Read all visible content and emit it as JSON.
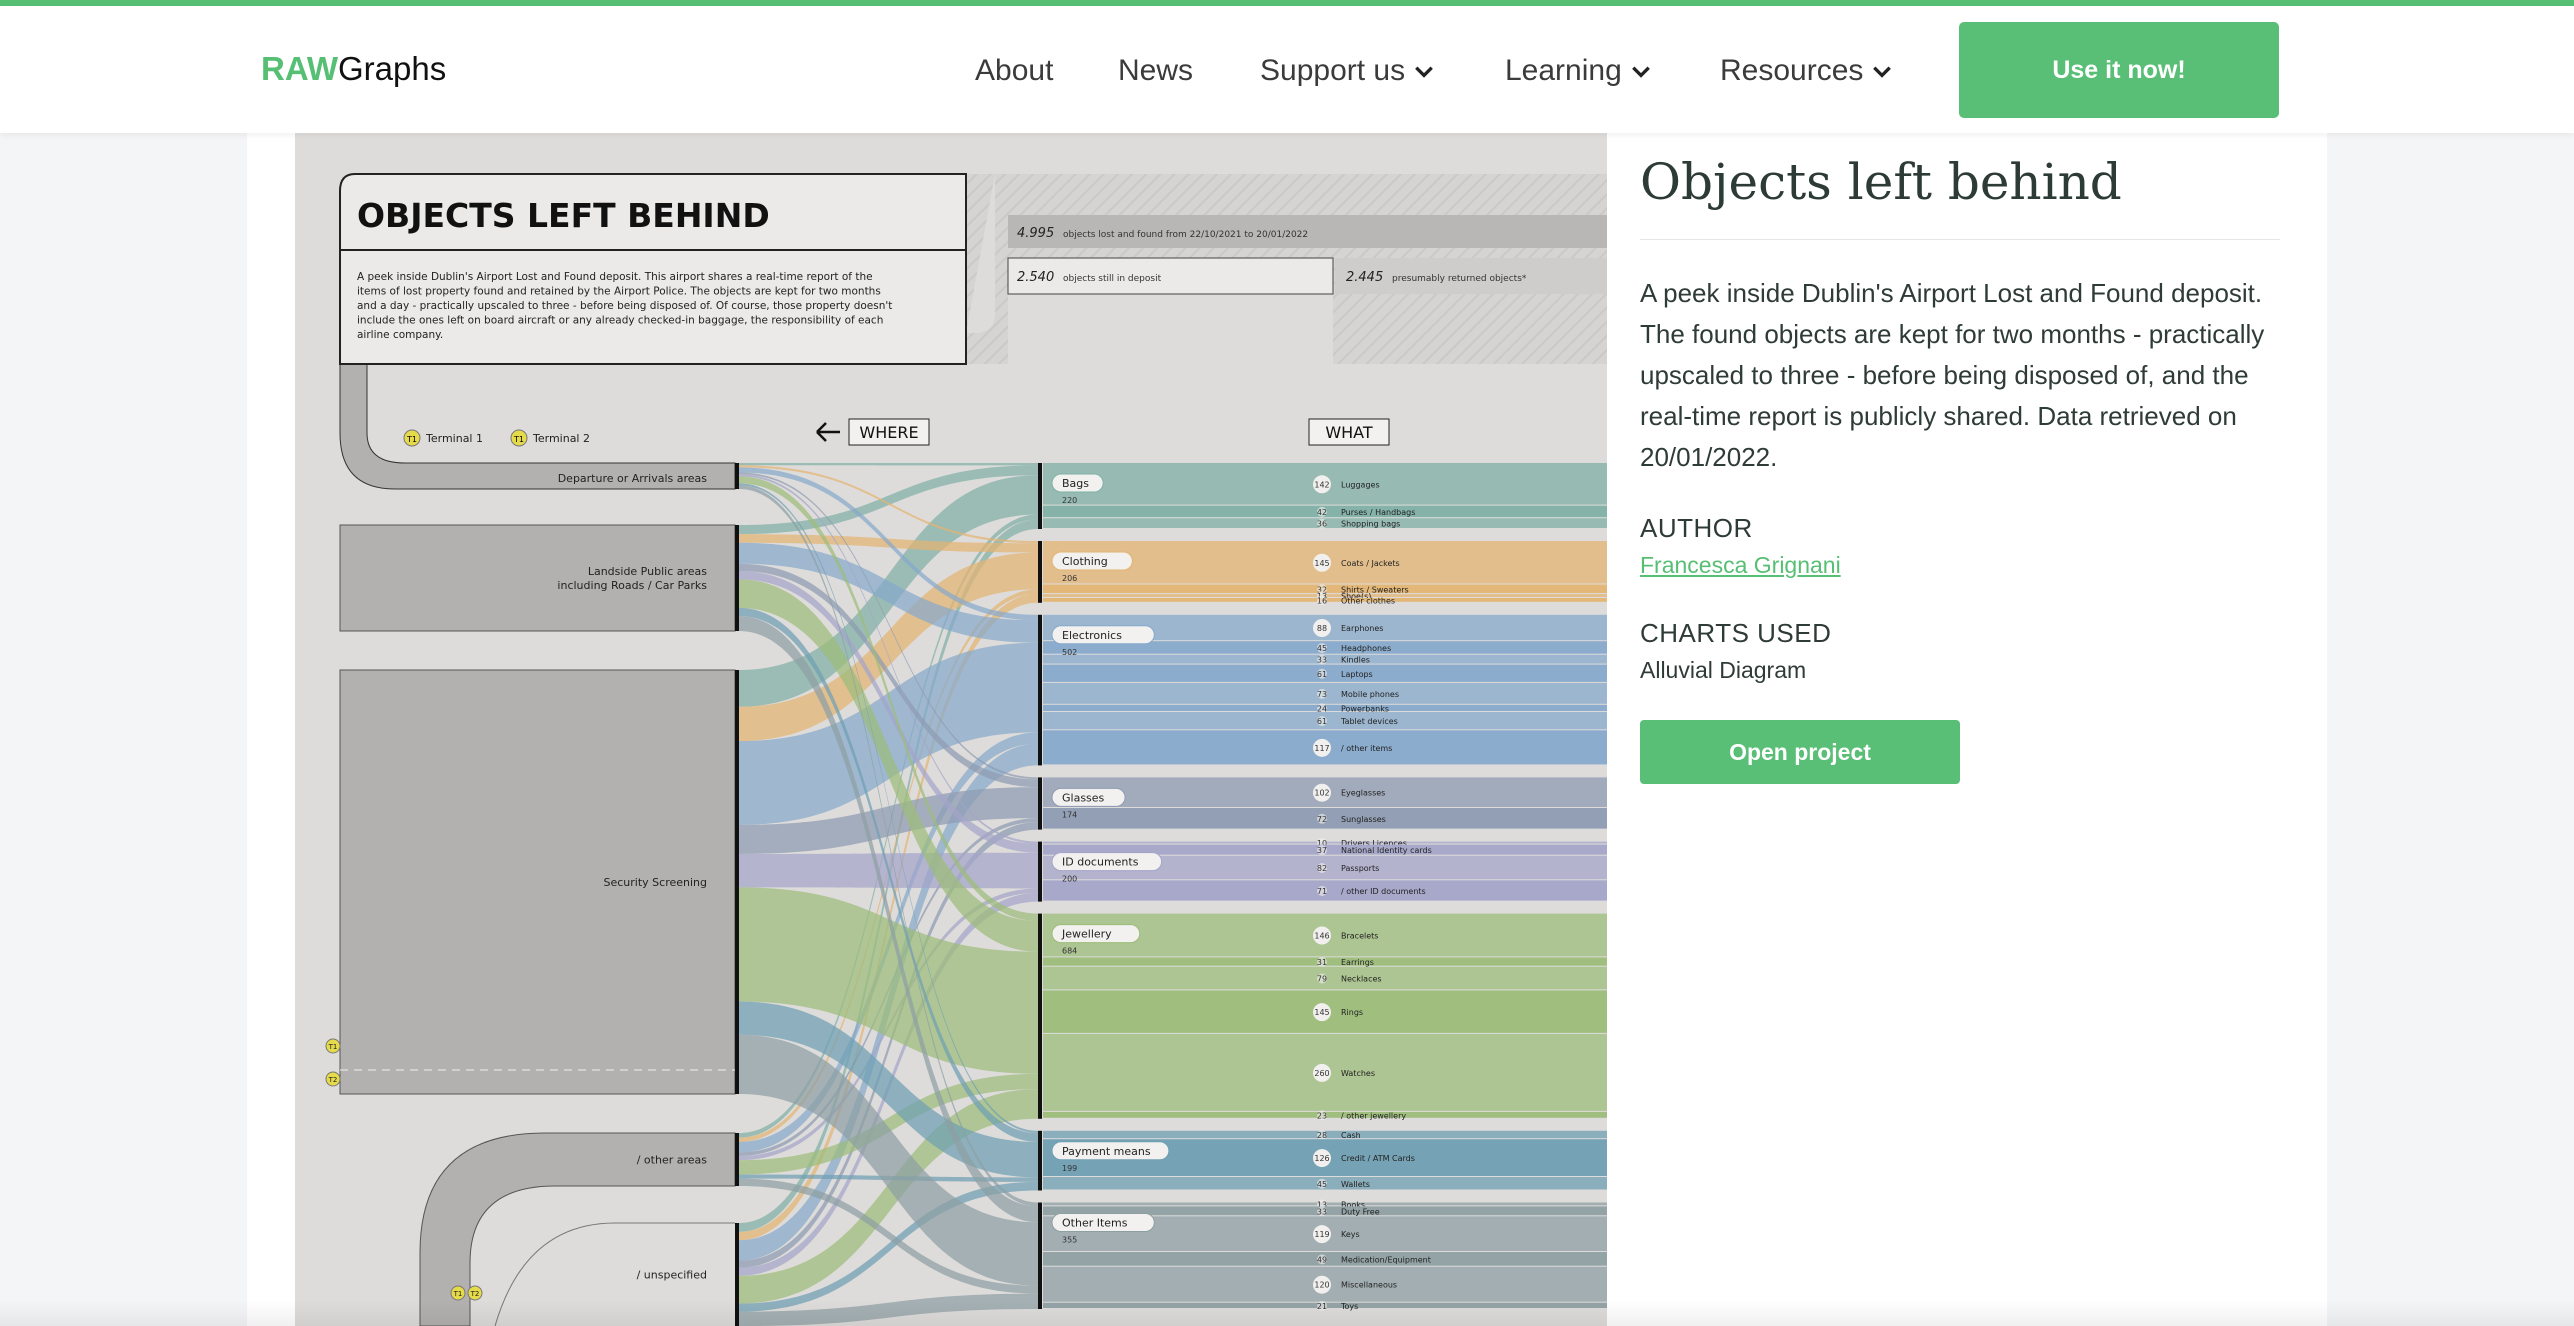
{
  "header": {
    "logo_bold": "RAW",
    "logo_rest": "Graphs",
    "nav": [
      {
        "label": "About",
        "dropdown": false
      },
      {
        "label": "News",
        "dropdown": false
      },
      {
        "label": "Support us",
        "dropdown": true
      },
      {
        "label": "Learning",
        "dropdown": true
      },
      {
        "label": "Resources",
        "dropdown": true
      }
    ],
    "cta_label": "Use it now!",
    "accent_color": "#57bf74"
  },
  "project": {
    "title": "Objects left behind",
    "description": "A peek inside Dublin's Airport Lost and Found deposit. The found objects are kept for two months - practically upscaled to three - before being disposed of, and the real-time report is publicly shared. Data retrieved on 20/01/2022.",
    "author_label": "AUTHOR",
    "author": "Francesca Grignani",
    "charts_label": "CHARTS USED",
    "chart_used": "Alluvial Diagram",
    "open_label": "Open project"
  },
  "poster": {
    "title": "OBJECTS LEFT BEHIND",
    "intro_lines": [
      "A peek inside Dublin's Airport Lost and Found deposit. This airport shares a real-time report of the",
      "items of lost property found and retained by the Airport Police. The objects are kept for two months",
      "and a day - practically upscaled to three - before being disposed of. Of course, those property doesn't",
      "include the ones left on board aircraft or any already checked-in baggage, the responsibility of each",
      "airline company."
    ],
    "total": {
      "value": "4.995",
      "text": "objects lost and found from 22/10/2021 to 20/01/2022"
    },
    "in_deposit": {
      "value": "2.540",
      "text": "objects still in deposit"
    },
    "returned": {
      "value": "2.445",
      "text": "presumably returned objects*"
    },
    "legend": [
      {
        "badge": "T1",
        "label": "Terminal 1"
      },
      {
        "badge": "T1",
        "label": "Terminal 2"
      }
    ],
    "where_label": "WHERE",
    "what_label": "WHAT",
    "where_nodes": [
      {
        "label": "Departure or Arrivals areas"
      },
      {
        "label": "Landside Public areas\nincluding Roads / Car Parks"
      },
      {
        "label": "Security Screening"
      },
      {
        "label": "/ other areas"
      },
      {
        "label": "/ unspecified"
      }
    ],
    "terminal_badges": [
      "T1",
      "T2"
    ],
    "categories": [
      {
        "name": "Bags",
        "total": 220,
        "color": "#7fb0a6",
        "items": [
          {
            "label": "Luggages",
            "value": 142
          },
          {
            "label": "Purses / Handbags",
            "value": 42
          },
          {
            "label": "Shopping bags",
            "value": 36
          }
        ]
      },
      {
        "name": "Clothing",
        "total": 206,
        "color": "#e3b472",
        "items": [
          {
            "label": "Coats / Jackets",
            "value": 145
          },
          {
            "label": "Shirts / Sweaters",
            "value": 32
          },
          {
            "label": "Shoe(s)",
            "value": 13
          },
          {
            "label": "Other clothes",
            "value": 16
          }
        ]
      },
      {
        "name": "Electronics",
        "total": 502,
        "color": "#86a9cb",
        "items": [
          {
            "label": "Earphones",
            "value": 88
          },
          {
            "label": "Headphones",
            "value": 45
          },
          {
            "label": "Kindles",
            "value": 33
          },
          {
            "label": "Laptops",
            "value": 61
          },
          {
            "label": "Mobile phones",
            "value": 73
          },
          {
            "label": "Powerbanks",
            "value": 24
          },
          {
            "label": "Tablet devices",
            "value": 61
          },
          {
            "label": "/ other items",
            "value": 117
          }
        ]
      },
      {
        "name": "Glasses",
        "total": 174,
        "color": "#8d9bb2",
        "items": [
          {
            "label": "Eyeglasses",
            "value": 102
          },
          {
            "label": "Sunglasses",
            "value": 72
          }
        ]
      },
      {
        "name": "ID documents",
        "total": 200,
        "color": "#a4a5c9",
        "items": [
          {
            "label": "Drivers Licences",
            "value": 10
          },
          {
            "label": "National Identity cards",
            "value": 37
          },
          {
            "label": "Passports",
            "value": 82
          },
          {
            "label": "/ other ID documents",
            "value": 71
          }
        ]
      },
      {
        "name": "Jewellery",
        "total": 684,
        "color": "#9cbd7a",
        "items": [
          {
            "label": "Bracelets",
            "value": 146
          },
          {
            "label": "Earrings",
            "value": 31
          },
          {
            "label": "Necklaces",
            "value": 79
          },
          {
            "label": "Rings",
            "value": 145
          },
          {
            "label": "Watches",
            "value": 260
          },
          {
            "label": "/ other jewellery",
            "value": 23
          }
        ]
      },
      {
        "name": "Payment means",
        "total": 199,
        "color": "#6f9fb3",
        "items": [
          {
            "label": "Cash",
            "value": 28
          },
          {
            "label": "Credit / ATM Cards",
            "value": 126
          },
          {
            "label": "Wallets",
            "value": 45
          }
        ]
      },
      {
        "name": "Other Items",
        "total": 355,
        "color": "#8e9fa3",
        "items": [
          {
            "label": "Books",
            "value": 13
          },
          {
            "label": "Duty Free",
            "value": 33
          },
          {
            "label": "Keys",
            "value": 119
          },
          {
            "label": "Medication/Equipment",
            "value": 49
          },
          {
            "label": "Miscellaneous",
            "value": 120
          },
          {
            "label": "Toys",
            "value": 21
          }
        ]
      }
    ]
  }
}
